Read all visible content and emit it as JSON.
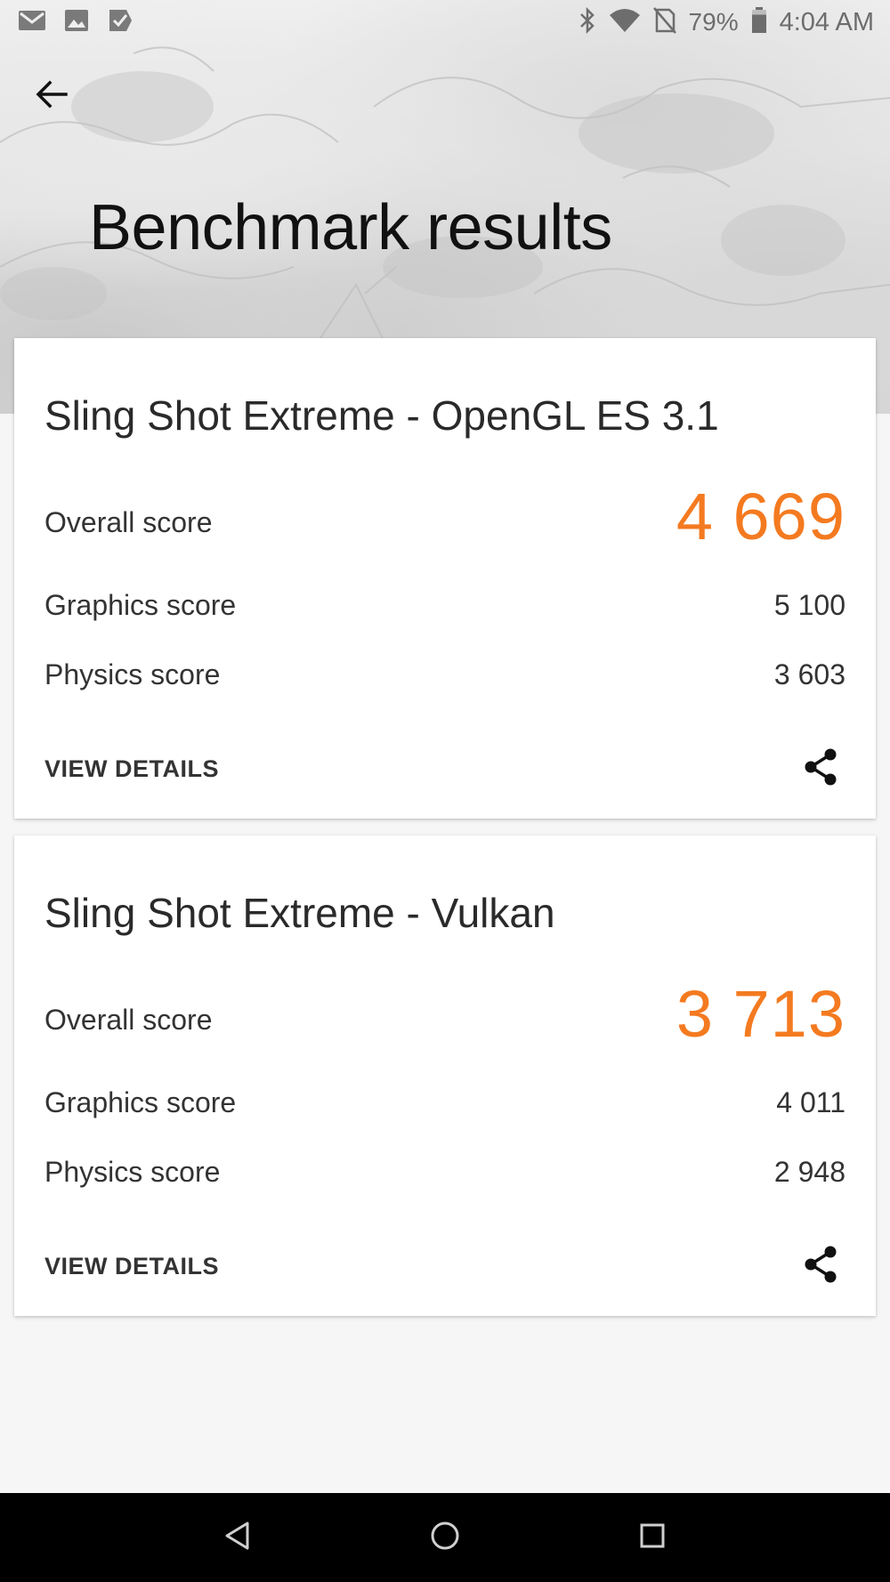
{
  "status_bar": {
    "icons_left": [
      "gmail-icon",
      "image-icon",
      "check-mark-notification-icon"
    ],
    "icons_right": [
      "bluetooth-icon",
      "wifi-icon",
      "no-sim-icon"
    ],
    "battery_percent": "79%",
    "battery_level": 0.79,
    "time": "4:04 AM"
  },
  "header": {
    "title": "Benchmark results",
    "back_icon": "arrow-back-icon"
  },
  "results": [
    {
      "title": "Sling Shot Extreme - OpenGL ES 3.1",
      "overall_label": "Overall score",
      "overall_value": "4 669",
      "graphics_label": "Graphics score",
      "graphics_value": "5 100",
      "physics_label": "Physics score",
      "physics_value": "3 603",
      "details_label": "VIEW DETAILS",
      "share_icon": "share-icon"
    },
    {
      "title": "Sling Shot Extreme - Vulkan",
      "overall_label": "Overall score",
      "overall_value": "3 713",
      "graphics_label": "Graphics score",
      "graphics_value": "4 011",
      "physics_label": "Physics score",
      "physics_value": "2 948",
      "details_label": "VIEW DETAILS",
      "share_icon": "share-icon"
    }
  ],
  "nav_bar": {
    "icons": [
      "nav-back-icon",
      "nav-home-icon",
      "nav-recents-icon"
    ]
  },
  "colors": {
    "accent": "#f47a20",
    "background": "#f6f6f6",
    "card": "#ffffff",
    "nav_bar": "#000000"
  }
}
